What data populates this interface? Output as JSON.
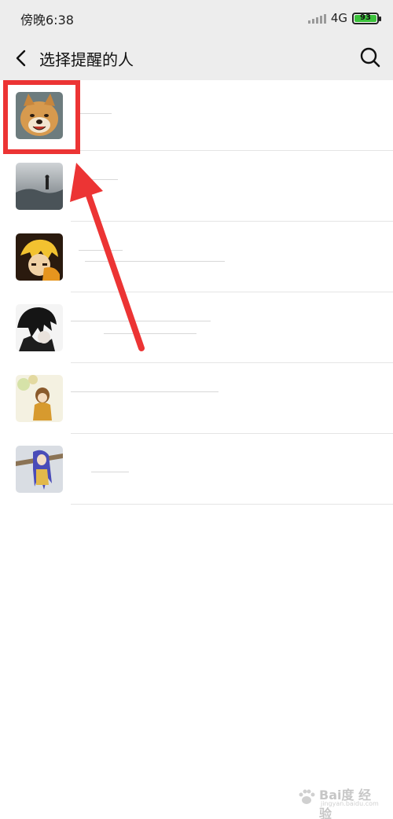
{
  "status_bar": {
    "time": "傍晚6:38",
    "network": "4G",
    "battery": "93"
  },
  "header": {
    "title": "选择提醒的人"
  },
  "contacts": [
    {
      "avatar": "shiba-dog-photo",
      "name": ""
    },
    {
      "avatar": "person-in-mist-photo",
      "name": ""
    },
    {
      "avatar": "anime-boy-golden-hair",
      "name": ""
    },
    {
      "avatar": "anime-dark-silhouette",
      "name": ""
    },
    {
      "avatar": "anime-girl-autumn",
      "name": ""
    },
    {
      "avatar": "anime-girl-blue-hair",
      "name": ""
    }
  ],
  "watermark": {
    "brand": "Bai度 经验",
    "url": "jingyan.baidu.com"
  },
  "colors": {
    "bar_bg": "#ededed",
    "highlight": "#ec3434",
    "battery": "#3cc23c"
  }
}
